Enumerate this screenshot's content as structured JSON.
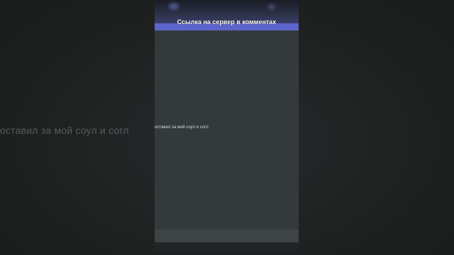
{
  "video": {
    "banner_text": "Ссылка на сервер в комментах",
    "caption_text": "оставил за мой соул и согл",
    "background_caption_text": "оставил за мой соул и согл"
  },
  "colors": {
    "banner": "#5c64cc",
    "chat_background": "#343a3b",
    "letterbox": "#202222"
  }
}
